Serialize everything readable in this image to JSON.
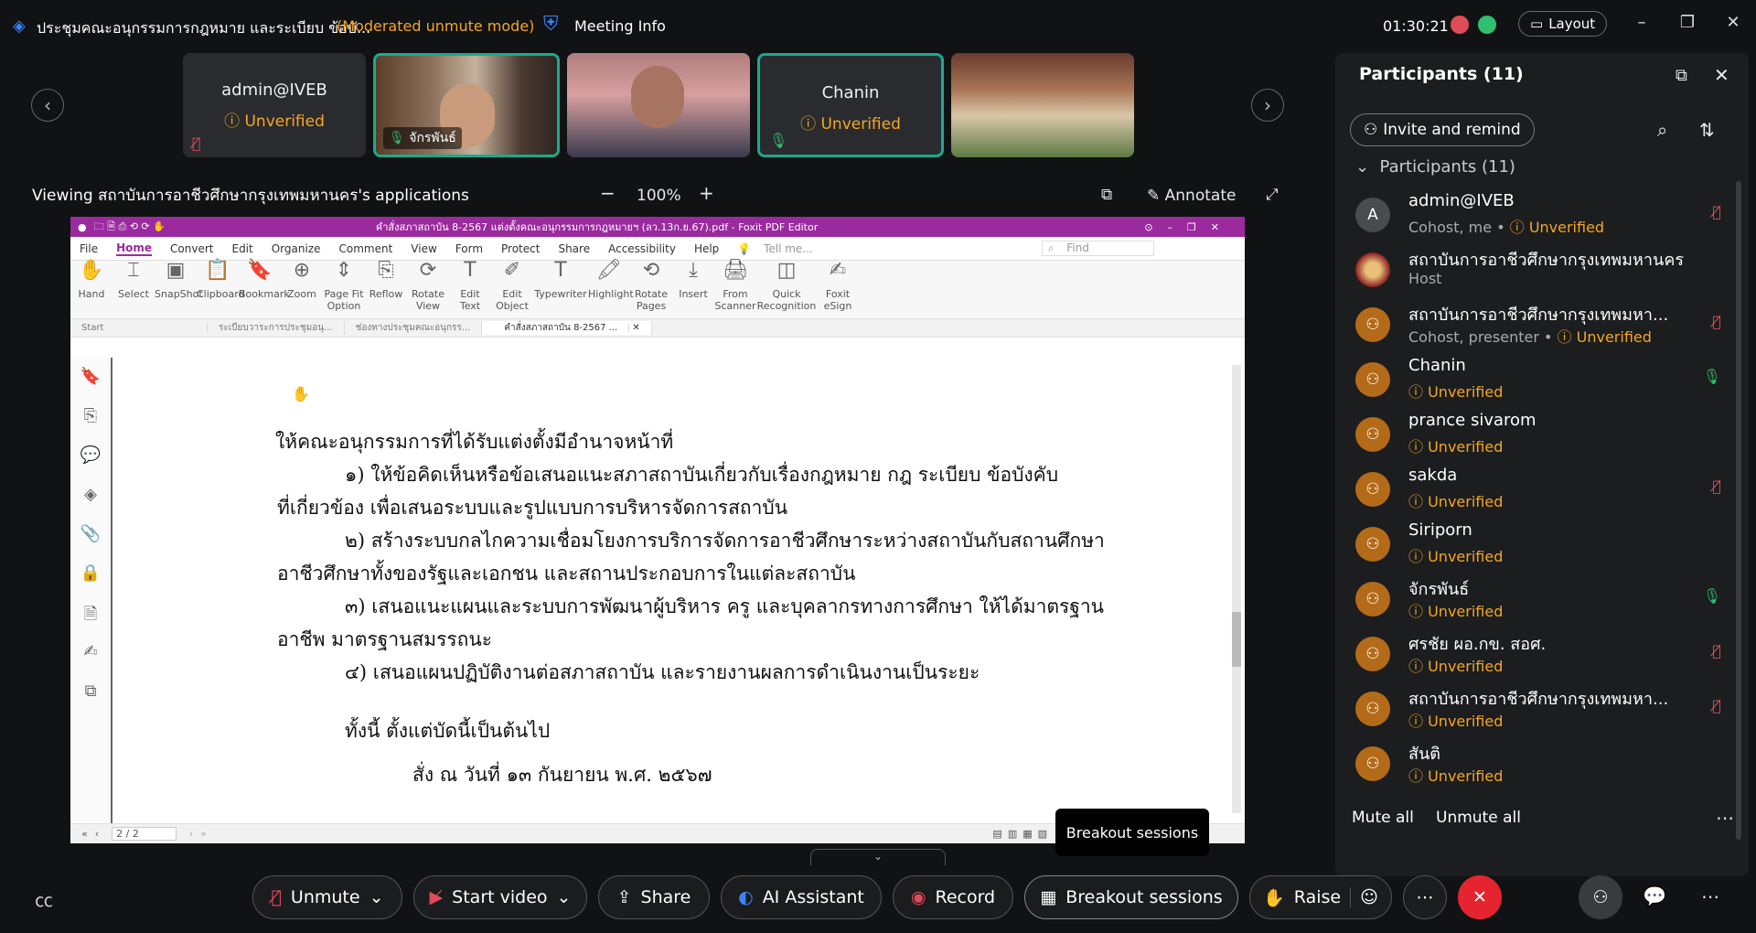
{
  "window": {
    "title": "ประชุมคณะอนุกรรมการกฎหมาย และระเบียบ ข้อบั...",
    "mode": "(Moderated unmute mode)",
    "meeting_info": "Meeting Info",
    "timer": "01:30:21",
    "layout_label": "Layout"
  },
  "strip": {
    "tiles": [
      {
        "name": "admin@IVEB",
        "status": "Unverified",
        "muted": true
      },
      {
        "name": "จักรพันธ์",
        "status": "",
        "muted": false,
        "video": true
      },
      {
        "name": "",
        "status": "",
        "video": true
      },
      {
        "name": "Chanin",
        "status": "Unverified",
        "muted": false
      },
      {
        "name": "",
        "status": "",
        "video": true
      }
    ]
  },
  "share": {
    "viewing": "Viewing สถาบันการอาชีวศึกษากรุงเทพมหานคร's applications",
    "zoom": "100%",
    "annotate": "Annotate"
  },
  "pdf": {
    "title": "คำสั่งสภาสถาบัน 8-2567 แต่งตั้งคณะอนุกรรมการกฎหมายฯ (ลว.13ก.ย.67).pdf - Foxit PDF Editor",
    "menu": [
      "File",
      "Home",
      "Convert",
      "Edit",
      "Organize",
      "Comment",
      "View",
      "Form",
      "Protect",
      "Share",
      "Accessibility",
      "Help"
    ],
    "tell_me": "Tell me...",
    "find": "Find",
    "tools": [
      "Hand",
      "Select",
      "SnapShot",
      "Clipboard",
      "Bookmark",
      "Zoom",
      "Page Fit Option",
      "Reflow",
      "Rotate View",
      "Edit Text",
      "Edit Object",
      "Typewriter",
      "Highlight",
      "Rotate Pages",
      "Insert",
      "From Scanner",
      "Quick Recognition",
      "Foxit eSign"
    ],
    "tabs": [
      "Start",
      "ระเบียบวาระการประชุมอนุ...",
      "ช่องทางประชุมคณะอนุกรร...",
      "คำสั่งสภาสถาบัน 8-2567 ..."
    ],
    "lines": [
      "ให้คณะอนุกรรมการที่ได้รับแต่งตั้งมีอำนาจหน้าที่",
      "๑) ให้ข้อคิดเห็นหรือข้อเสนอแนะสภาสถาบันเกี่ยวกับเรื่องกฎหมาย กฎ ระเบียบ ข้อบังคับ",
      "ที่เกี่ยวข้อง เพื่อเสนอระบบและรูปแบบการบริหารจัดการสถาบัน",
      "๒) สร้างระบบกลไกความเชื่อมโยงการบริการจัดการอาชีวศึกษาระหว่างสถาบันกับสถานศึกษา",
      "อาชีวศึกษาทั้งของรัฐและเอกชน และสถานประกอบการในแต่ละสถาบัน",
      "๓) เสนอแนะแผนและระบบการพัฒนาผู้บริหาร ครู และบุคลากรทางการศึกษา ให้ได้มาตรฐาน",
      "อาชีพ มาตรฐานสมรรถนะ",
      "๔) เสนอแผนปฏิบัติงานต่อสภาสถาบัน และรายงานผลการดำเนินงานเป็นระยะ",
      "ทั้งนี้ ตั้งแต่บัดนี้เป็นต้นไป",
      "สั่ง ณ วันที่ ๑๓ กันยายน พ.ศ. ๒๕๖๗"
    ],
    "page": "2 / 2"
  },
  "panel": {
    "title": "Participants (11)",
    "invite": "Invite and remind",
    "section": "Participants (11)",
    "people": [
      {
        "name": "admin@IVEB",
        "role": "Cohost, me",
        "status": "Unverified",
        "avatar": "A",
        "mic": "off"
      },
      {
        "name": "สถาบันการอาชีวศึกษากรุงเทพมหานคร",
        "role": "Host",
        "status": "",
        "avatar": "",
        "mic": "none"
      },
      {
        "name": "สถาบันการอาชีวศึกษากรุงเทพมหา...",
        "role": "Cohost, presenter",
        "status": "Unverified",
        "avatar": "",
        "mic": "off"
      },
      {
        "name": "Chanin",
        "role": "",
        "status": "Unverified",
        "avatar": "",
        "mic": "on"
      },
      {
        "name": "prance sivarom",
        "role": "",
        "status": "Unverified",
        "avatar": "",
        "mic": "none"
      },
      {
        "name": "sakda",
        "role": "",
        "status": "Unverified",
        "avatar": "",
        "mic": "off"
      },
      {
        "name": "Siriporn",
        "role": "",
        "status": "Unverified",
        "avatar": "",
        "mic": "none"
      },
      {
        "name": "จักรพันธ์",
        "role": "",
        "status": "Unverified",
        "avatar": "",
        "mic": "on"
      },
      {
        "name": "ศรชัย ผอ.กข. สอศ.",
        "role": "",
        "status": "Unverified",
        "avatar": "",
        "mic": "off"
      },
      {
        "name": "สถาบันการอาชีวศึกษากรุงเทพมหา...",
        "role": "",
        "status": "Unverified",
        "avatar": "",
        "mic": "off"
      },
      {
        "name": "สันติ",
        "role": "",
        "status": "Unverified",
        "avatar": "",
        "mic": "none"
      }
    ],
    "mute_all": "Mute all",
    "unmute_all": "Unmute all"
  },
  "footer": {
    "unmute": "Unmute",
    "start_video": "Start video",
    "share": "Share",
    "ai": "AI Assistant",
    "record": "Record",
    "breakout": "Breakout sessions",
    "raise": "Raise",
    "tooltip": "Breakout sessions"
  },
  "colors": {
    "accent": "#1ba98e",
    "warn": "#f5a623",
    "end": "#e5242f",
    "foxit": "#9b2a9f"
  }
}
